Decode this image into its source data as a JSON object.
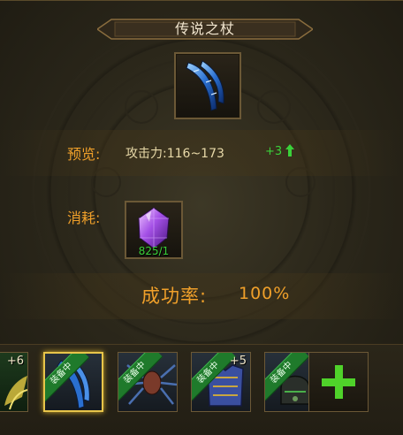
{
  "title": "传说之杖",
  "preview": {
    "label": "预览:",
    "attack_text": "攻击力:116~173",
    "bonus_text": "+3"
  },
  "cost": {
    "label": "消耗:",
    "count_text": "825/1"
  },
  "success": {
    "label": "成功率:",
    "value": "100%"
  },
  "equipment_list": [
    {
      "status": "",
      "level": "+6",
      "selected": false
    },
    {
      "status": "装备中",
      "level": "",
      "selected": true
    },
    {
      "status": "装备中",
      "level": "",
      "selected": false
    },
    {
      "status": "装备中",
      "level": "+5",
      "selected": false
    },
    {
      "status": "装备中",
      "level": "",
      "selected": false
    }
  ],
  "colors": {
    "accent": "#f0a02a",
    "bonus_green": "#3ad13a",
    "ribbon_green": "#1f7a2b",
    "selected_border": "#e8c54a"
  },
  "icons": {
    "add": "plus-icon",
    "up": "arrow-up-icon",
    "cost_item": "purple-crystal-icon"
  }
}
